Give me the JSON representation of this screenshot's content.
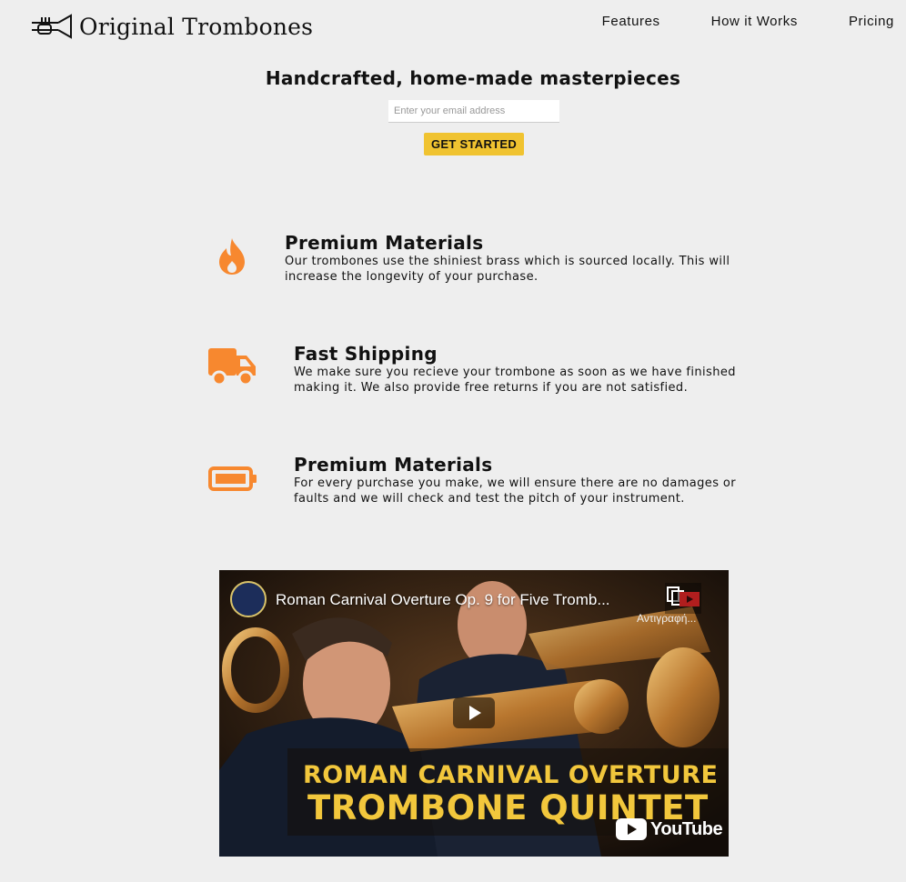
{
  "brand": {
    "name": "Original Trombones",
    "logo_icon": "trumpet-logo-icon"
  },
  "nav": {
    "features": "Features",
    "how_it_works": "How it Works",
    "pricing": "Pricing"
  },
  "hero": {
    "title": "Handcrafted, home-made masterpieces",
    "email_placeholder": "Enter your email address",
    "cta_label": "GET STARTED"
  },
  "colors": {
    "accent": "#f7882f",
    "cta": "#f0c330",
    "background": "#eeeeee"
  },
  "features": [
    {
      "icon": "fire-icon",
      "title": "Premium Materials",
      "text": "Our trombones use the shiniest brass which is sourced locally. This will increase the longevity of your purchase."
    },
    {
      "icon": "truck-icon",
      "title": "Fast Shipping",
      "text": "We make sure you recieve your trombone as soon as we have finished making it. We also provide free returns if you are not satisfied."
    },
    {
      "icon": "battery-icon",
      "title": "Premium Materials",
      "text": "For every purchase you make, we will ensure there are no damages or faults and we will check and test the pitch of your instrument."
    }
  ],
  "video": {
    "title": "Roman Carnival Overture Op. 9 for Five Tromb...",
    "copy_label": "Αντιγραφή...",
    "overlay_line1": "ROMAN CARNIVAL OVERTURE",
    "overlay_line2": "TROMBONE QUINTET",
    "platform": "YouTube"
  }
}
